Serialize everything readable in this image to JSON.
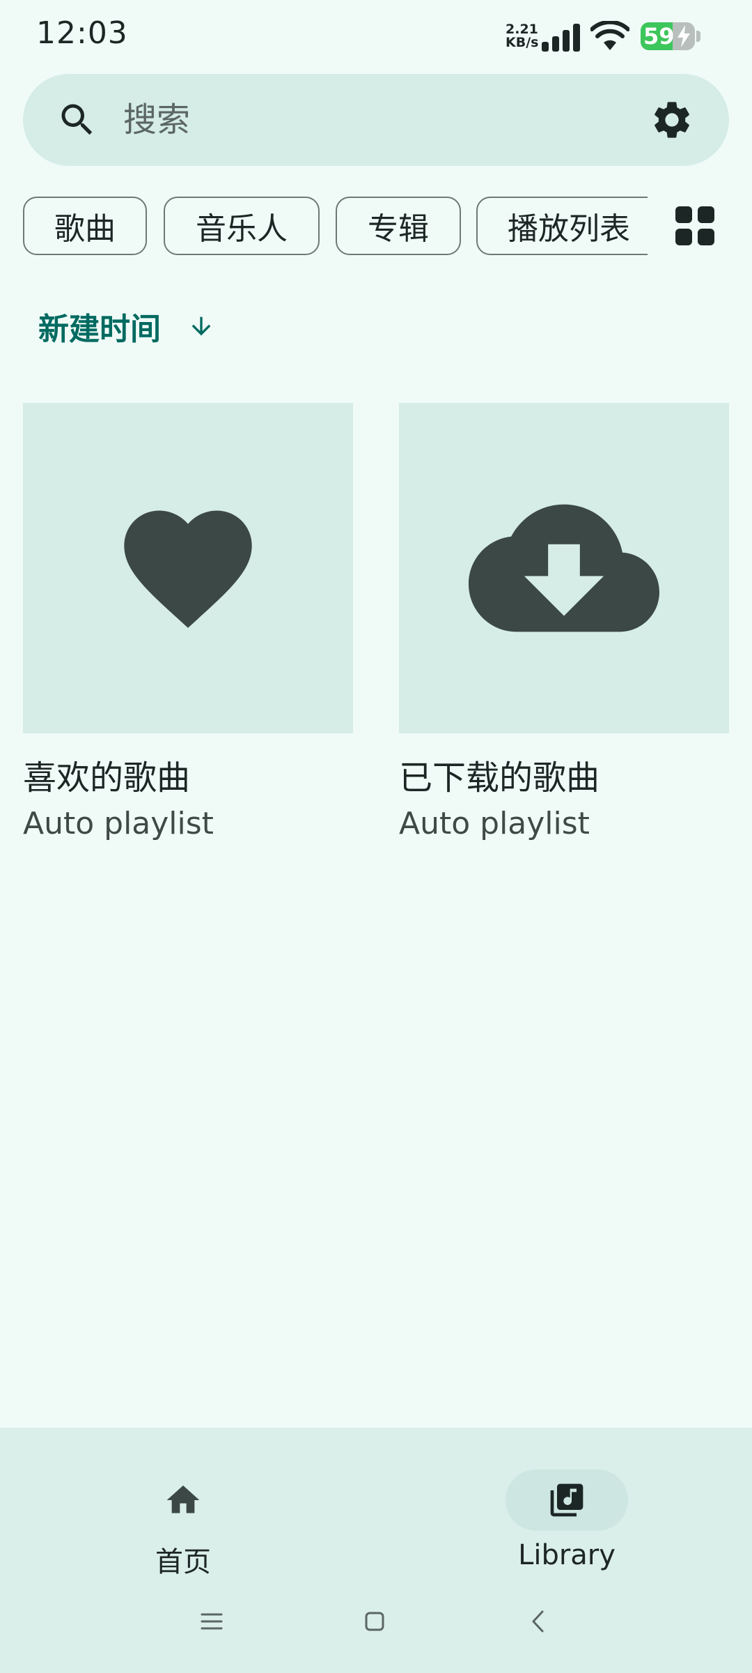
{
  "status_bar": {
    "time": "12:03",
    "net_speed_value": "2.21",
    "net_speed_unit": "KB/s",
    "battery_level": "59",
    "battery_percent": 59,
    "battery_color": "#3DC65B",
    "icons": [
      "signal-icon",
      "wifi-icon",
      "battery-icon",
      "charging-bolt-icon"
    ]
  },
  "search": {
    "placeholder": "搜索",
    "value": "",
    "icons": [
      "search-icon",
      "settings-gear-icon"
    ]
  },
  "filter_chips": [
    "歌曲",
    "音乐人",
    "专辑",
    "播放列表"
  ],
  "view_toggle_icon": "grid-view-icon",
  "sort": {
    "label": "新建时间",
    "direction_icon": "arrow-down-icon"
  },
  "playlists": [
    {
      "title": "喜欢的歌曲",
      "subtitle": "Auto playlist",
      "icon": "heart-icon"
    },
    {
      "title": "已下载的歌曲",
      "subtitle": "Auto playlist",
      "icon": "cloud-download-icon"
    }
  ],
  "bottom_nav": {
    "items": [
      {
        "label": "首页",
        "icon": "home-icon",
        "selected": false
      },
      {
        "label": "Library",
        "icon": "library-music-icon",
        "selected": true
      }
    ]
  },
  "system_nav": {
    "icons": [
      "recents-menu-icon",
      "home-square-icon",
      "back-chevron-icon"
    ]
  },
  "colors": {
    "background": "#F0FBF8",
    "surface_container": "#D5ECE7",
    "accent": "#006A60",
    "icon_dark": "#3C4845",
    "nav_background": "#DAEEEA",
    "nav_indicator": "#CDE6E1"
  }
}
